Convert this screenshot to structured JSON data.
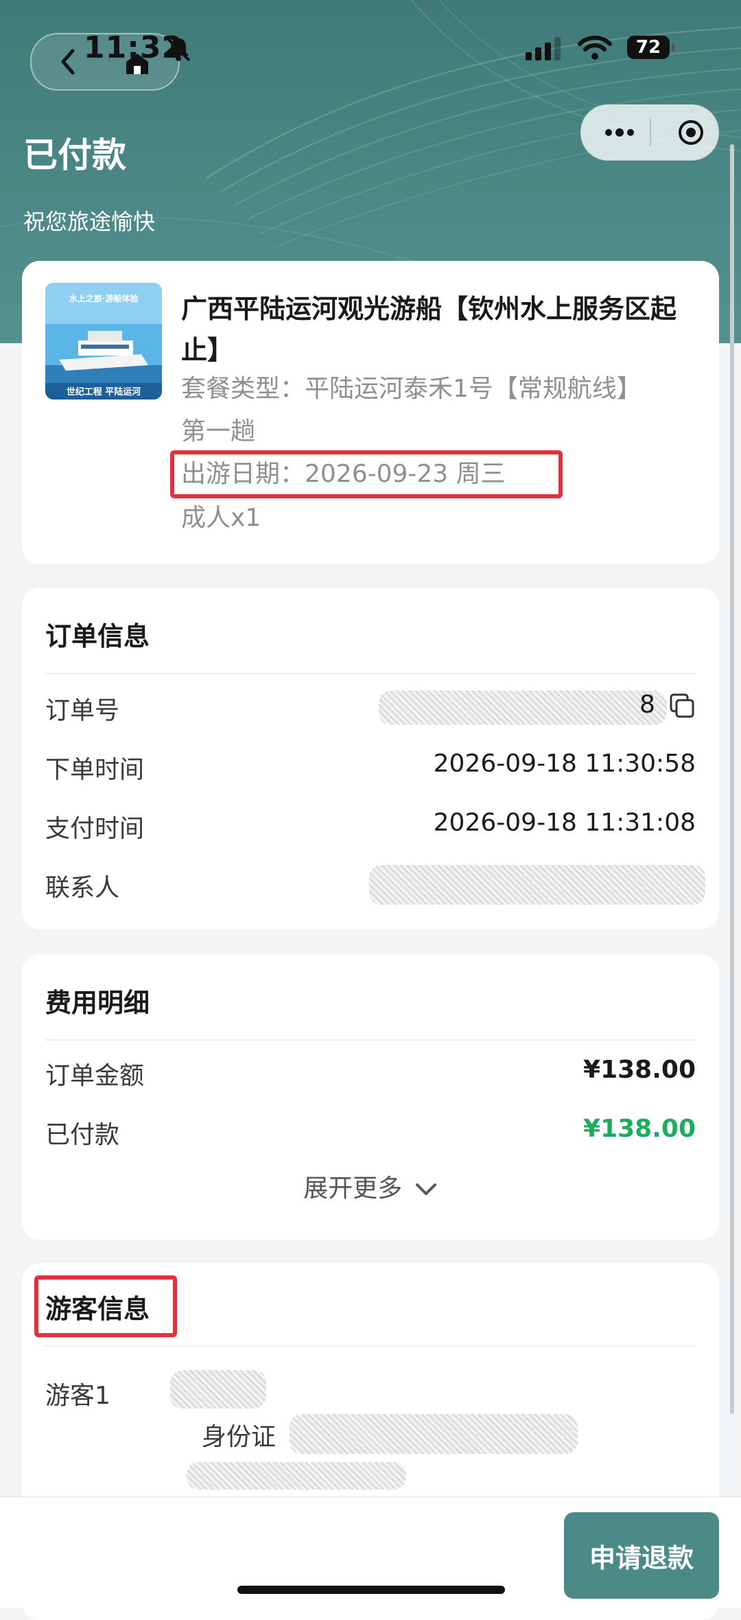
{
  "status_bar": {
    "time": "11:32",
    "battery": "72"
  },
  "header": {
    "title": "已付款",
    "subtitle": "祝您旅途愉快"
  },
  "product": {
    "title": "广西平陆运河观光游船【钦州水上服务区起止】",
    "package": "套餐类型：平陆运河泰禾1号【常规航线】",
    "trip": "第一趟",
    "date": "出游日期：2026-09-23 周三",
    "tickets": "成人x1",
    "thumb_text_top": "水上之旅·游船体验",
    "thumb_text_bottom": "世纪工程 平陆运河"
  },
  "order_info": {
    "title": "订单信息",
    "order_no_label": "订单号",
    "order_no_tail": "8",
    "order_time_label": "下单时间",
    "order_time": "2026-09-18 11:30:58",
    "pay_time_label": "支付时间",
    "pay_time": "2026-09-18 11:31:08",
    "contact_label": "联系人"
  },
  "fees": {
    "title": "费用明细",
    "amount_label": "订单金额",
    "amount": "¥138.00",
    "paid_label": "已付款",
    "paid": "¥138.00",
    "expand_label": "展开更多"
  },
  "visitors": {
    "title": "游客信息",
    "visitor_label": "游客1",
    "id_label": "身份证"
  },
  "actions": {
    "refund_label": "申请退款"
  },
  "colors": {
    "accent": "#4b8a87",
    "paid_green": "#1aad5e",
    "highlight_red": "#e4303d"
  }
}
